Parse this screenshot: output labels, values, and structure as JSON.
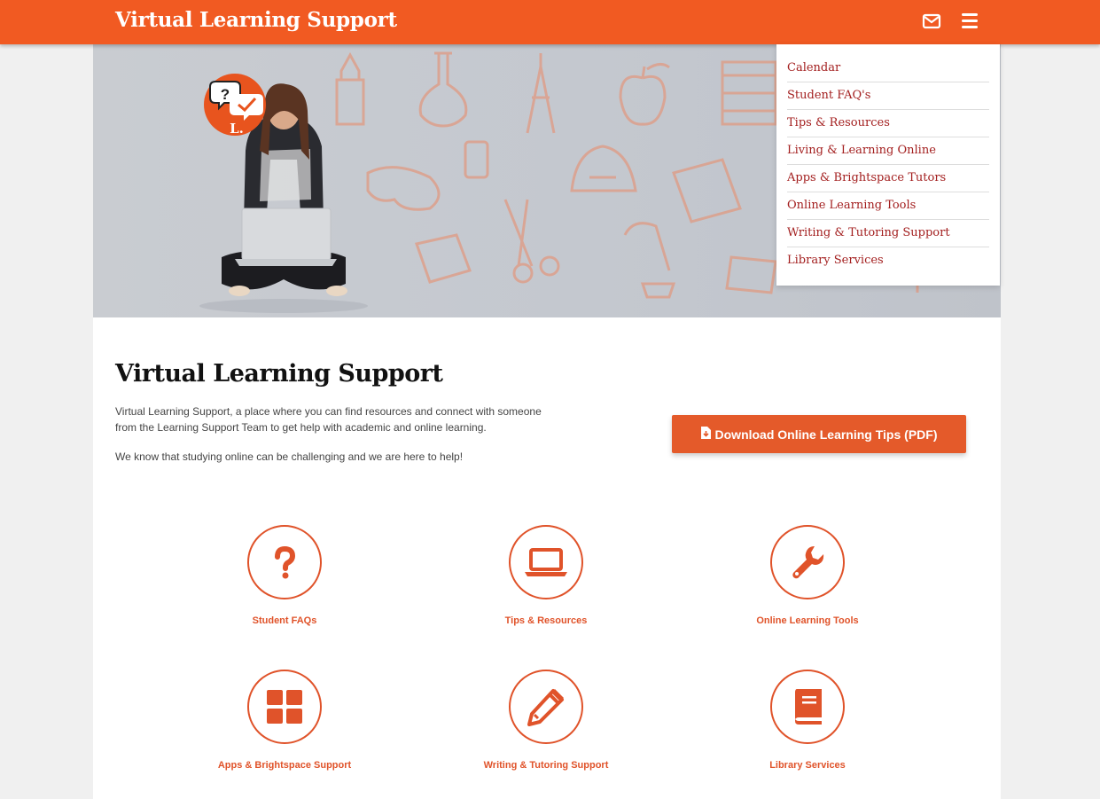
{
  "header": {
    "title": "Virtual Learning Support",
    "mail_icon": "envelope-icon",
    "menu_icon": "hamburger-icon"
  },
  "hero": {
    "badge_icon": "question-check-speech-bubbles-icon",
    "badge_letter": "L."
  },
  "dropdown": {
    "items": [
      "Calendar",
      "Student FAQ's",
      "Tips & Resources",
      "Living & Learning Online",
      "Apps & Brightspace Tutors",
      "Online Learning Tools",
      "Writing & Tutoring Support",
      "Library Services"
    ]
  },
  "intro": {
    "title": "Virtual Learning Support",
    "paragraph1": "Virtual Learning Support, a place where you can find resources and connect with someone from the Learning Support Team to get help with academic and online learning.",
    "paragraph2": "We know that studying online can be challenging and we are here to help!"
  },
  "download_button": {
    "label": "Download Online Learning Tips (PDF)",
    "icon": "file-download-icon"
  },
  "cards": [
    {
      "label": "Student FAQs",
      "icon": "question-icon"
    },
    {
      "label": "Tips & Resources",
      "icon": "laptop-icon"
    },
    {
      "label": "Online Learning Tools",
      "icon": "wrench-icon"
    },
    {
      "label": "Apps & Brightspace Support",
      "icon": "grid-icon"
    },
    {
      "label": "Writing & Tutoring Support",
      "icon": "pencil-icon"
    },
    {
      "label": "Library Services",
      "icon": "book-icon"
    }
  ],
  "colors": {
    "brand_orange": "#f15a22",
    "link_red": "#a31f1f",
    "card_orange": "#e0532a"
  }
}
